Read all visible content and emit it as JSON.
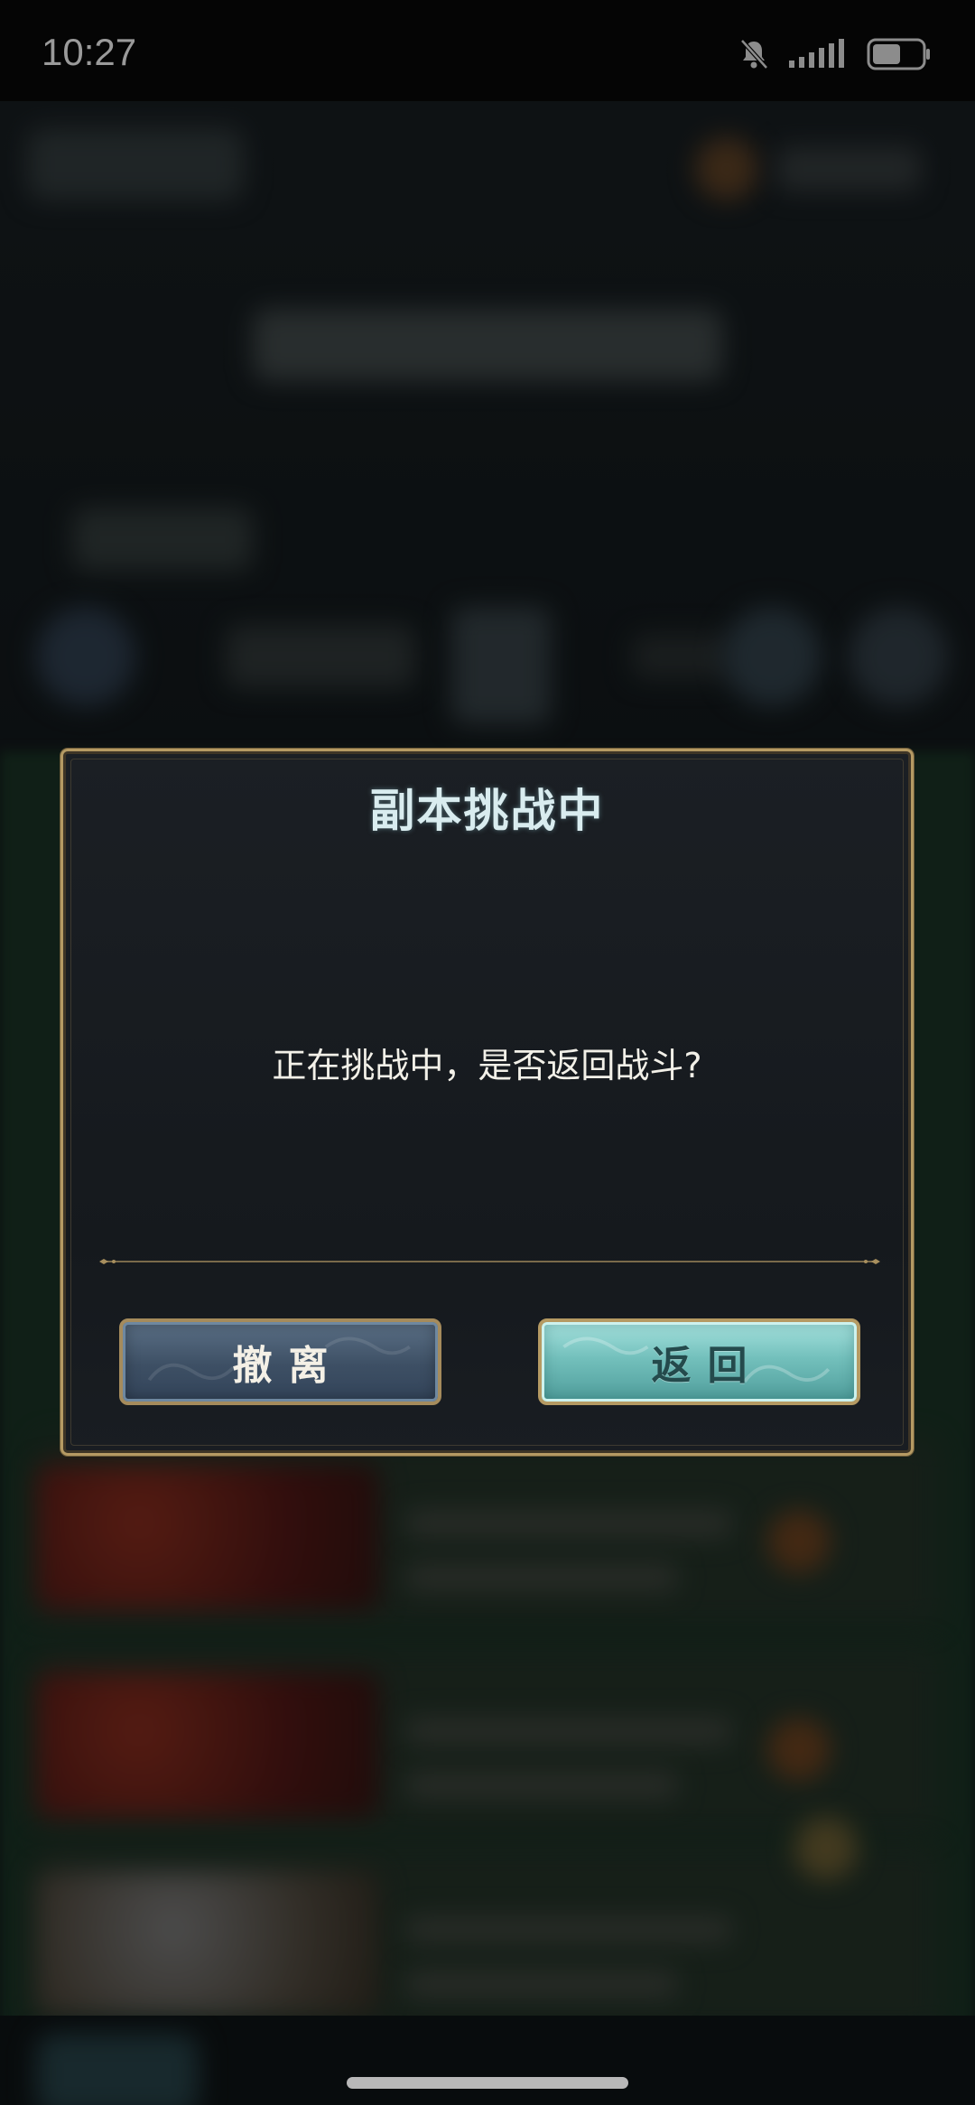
{
  "status_bar": {
    "time": "10:27",
    "icons": [
      "bell-muted-icon",
      "signal-icon",
      "battery-icon"
    ]
  },
  "dialog": {
    "title": "副本挑战中",
    "message": "正在挑战中，是否返回战斗?",
    "buttons": {
      "retreat_label": "撤离",
      "return_label": "返回"
    }
  },
  "colors": {
    "dialog_border": "#b59a63",
    "retreat_button": "#3d4f64",
    "return_button": "#73c0bc",
    "title_text": "#d9ecef"
  }
}
